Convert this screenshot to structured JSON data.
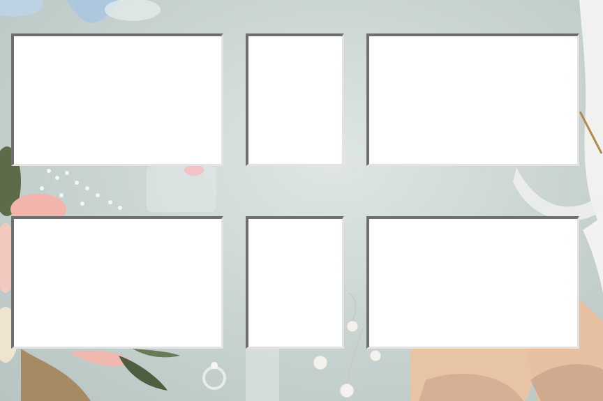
{
  "background": {
    "description_colors": {
      "surface": "#cbd6d4",
      "rose": "#f2b7b0",
      "greenery": "#5f6f4e",
      "dried_grass": "#a58a63",
      "shoe": "#e8c4a6",
      "ribbon": "#a9c7e0",
      "pearl": "#f4f2ee"
    }
  },
  "frame": {
    "slot_color": "#ffffff",
    "slot_count": 6
  }
}
